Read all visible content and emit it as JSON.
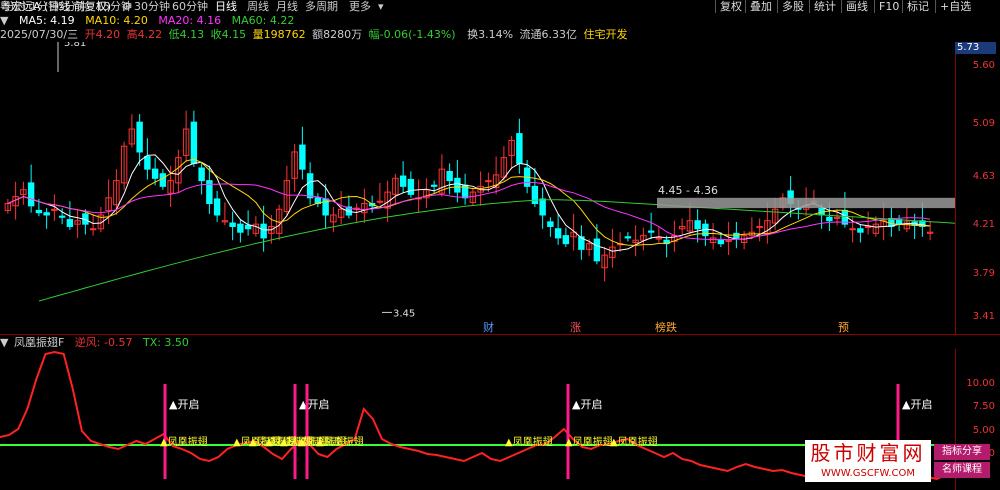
{
  "topbar": {
    "title": "粤宏远A (日线 前复权)",
    "periods": [
      "分时",
      "1分钟",
      "5分钟",
      "15分钟",
      "30分钟",
      "60分钟",
      "日线",
      "周线",
      "月线",
      "多周期",
      "更多"
    ],
    "active_period": "日线",
    "right_buttons": [
      "复权",
      "叠加",
      "多股",
      "统计",
      "画线",
      "F10",
      "标记",
      "+自选"
    ]
  },
  "ma_legend": [
    {
      "label": "MA5: 4.19",
      "color": "#ffffff"
    },
    {
      "label": "MA10: 4.20",
      "color": "#ffd700"
    },
    {
      "label": "MA20: 4.16",
      "color": "#ff33ff"
    },
    {
      "label": "MA60: 4.22",
      "color": "#33cc33"
    }
  ],
  "info": {
    "date": "2025/07/30/三",
    "open": "开4.20",
    "high": "高4.22",
    "low": "低4.13",
    "close": "收4.15",
    "volume": "量198762",
    "amount": "额8280万",
    "change": "幅-0.06(-1.43%)",
    "turnover": "换3.14%",
    "float": "流通6.33亿",
    "sector": "住宅开发"
  },
  "price_axis": {
    "current": "5.73",
    "ticks": [
      "5.60",
      "5.09",
      "4.63",
      "4.21",
      "3.79",
      "3.41"
    ]
  },
  "annotations": {
    "high": "5.81",
    "low": "3.45",
    "range": "4.45 - 4.36"
  },
  "event_badges": [
    "财",
    "涨",
    "榜跌",
    "预"
  ],
  "colors": {
    "up": "#ff3333",
    "down": "#00ffff",
    "ma5": "#ffffff",
    "ma10": "#ffd700",
    "ma20": "#ff33ff",
    "ma60": "#33cc33",
    "axis": "#e33333"
  },
  "sub": {
    "title": "凤凰振翅F",
    "inverse_label": "逆风: -0.57",
    "tx_label": "TX: 3.50",
    "axis_ticks": [
      "10.00",
      "7.50",
      "5.00",
      "2.50"
    ],
    "open_label": "开启",
    "wing_label": "凤凰振翅"
  },
  "watermark": {
    "site": "股市财富网",
    "url": "WWW.GSCFW.COM",
    "tag1": "指标分享",
    "tag2": "名师课程"
  }
}
